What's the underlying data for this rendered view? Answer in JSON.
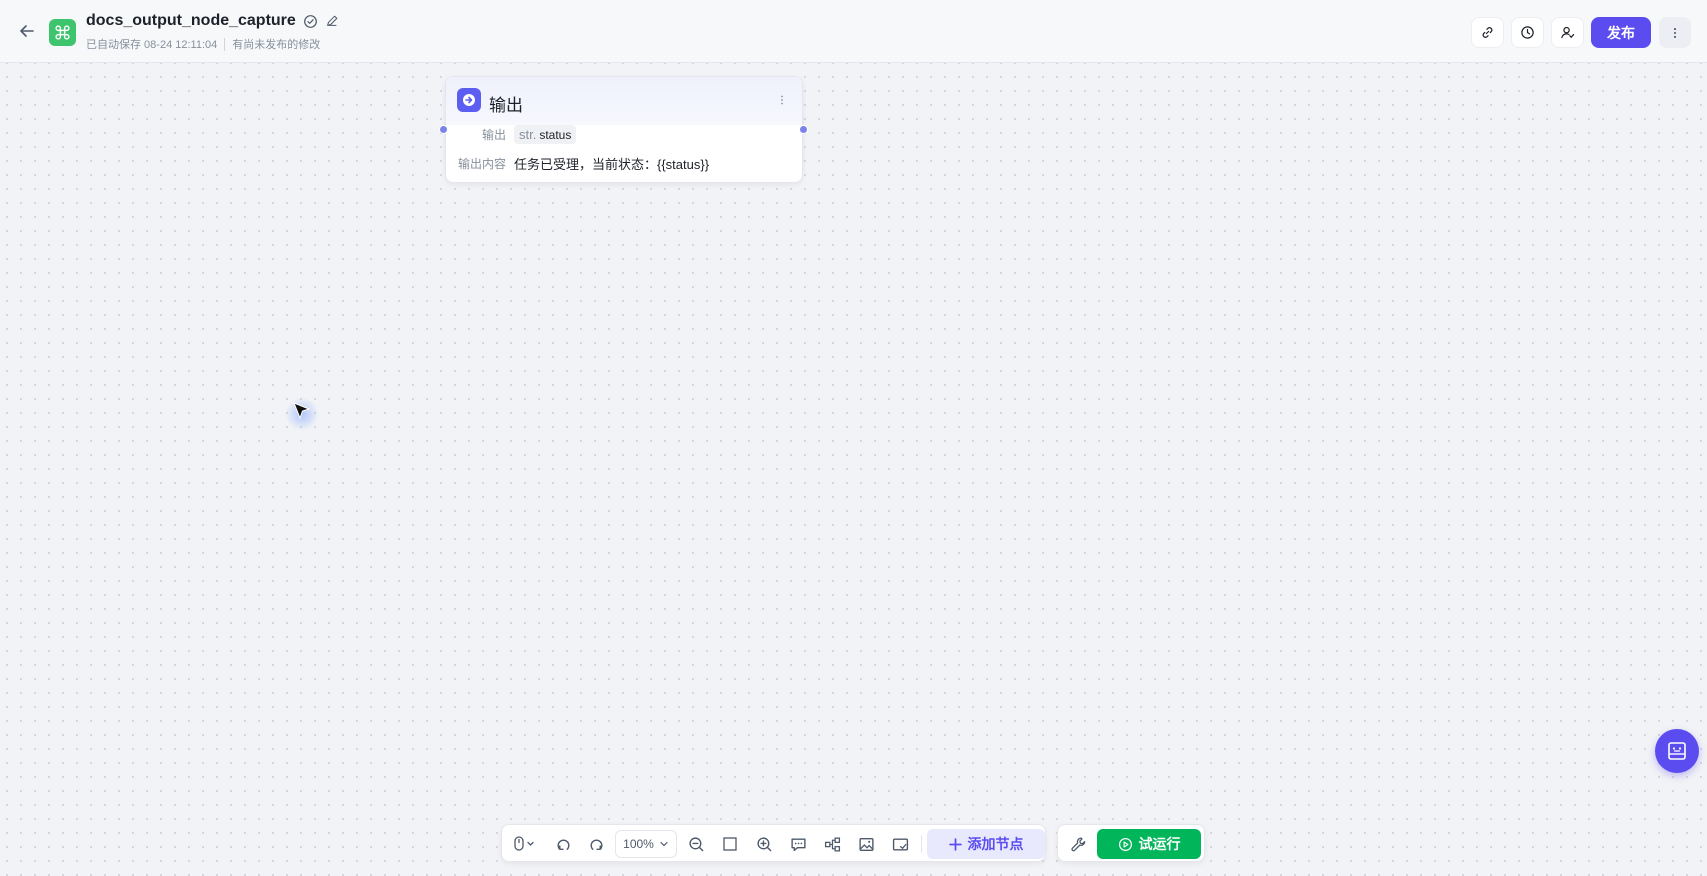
{
  "header": {
    "title": "docs_output_node_capture",
    "autosave": "已自动保存 08-24 12:11:04",
    "unpublished": "有尚未发布的修改",
    "publish_label": "发布"
  },
  "icons": {
    "back": "arrow-left-icon",
    "logo": "command-icon",
    "status": "check-circle-icon",
    "edit": "pencil-icon",
    "link": "link-icon",
    "history": "clock-icon",
    "user": "user-icon",
    "more": "more-vertical-icon"
  },
  "node": {
    "title": "输出",
    "output_label": "输出",
    "var_type": "str.",
    "var_name": "status",
    "content_label": "输出内容",
    "content_value": "任务已受理，当前状态：{{status}}"
  },
  "toolbar": {
    "zoom": "100%",
    "add_node_label": "添加节点",
    "run_label": "试运行"
  },
  "colors": {
    "brand": "#5b4cf0",
    "run": "#00b55a",
    "logo": "#3ec46d",
    "node_icon": "#5b5ef0"
  }
}
